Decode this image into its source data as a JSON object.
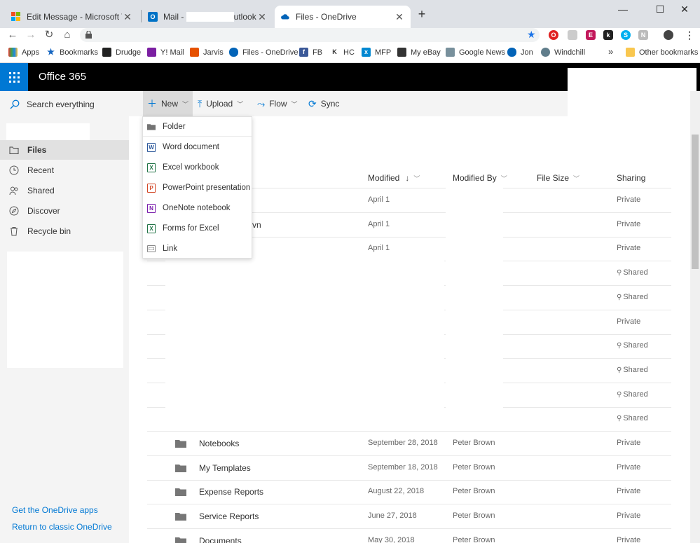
{
  "browser": {
    "tabs": [
      {
        "title": "Edit Message - Microsoft Tech Co",
        "favicon": "microsoft-icon"
      },
      {
        "title": "Mail - ",
        "title_suffix": "utlook",
        "favicon": "outlook-icon"
      },
      {
        "title": "Files - OneDrive",
        "favicon": "onedrive-icon",
        "active": true
      }
    ],
    "new_tab": "+",
    "window_controls": [
      "—",
      "☐",
      "✕"
    ],
    "nav": {
      "back": "←",
      "forward": "→",
      "reload": "↻",
      "home": "⌂"
    },
    "bookmarks": [
      {
        "label": "Apps",
        "icon": "apps-grid-icon"
      },
      {
        "label": "Bookmarks",
        "icon": "star-icon"
      },
      {
        "label": "Drudge",
        "icon": "drudge-icon"
      },
      {
        "label": "Y! Mail",
        "icon": "yahoo-mail-icon"
      },
      {
        "label": "Jarvis",
        "icon": "jarvis-icon"
      },
      {
        "label": "Files - OneDrive",
        "icon": "onedrive-icon"
      },
      {
        "label": "FB",
        "icon": "facebook-icon"
      },
      {
        "label": "HC",
        "icon": "hc-icon"
      },
      {
        "label": "MFP",
        "icon": "mfp-icon"
      },
      {
        "label": "My eBay",
        "icon": "ebay-icon"
      },
      {
        "label": "Google News",
        "icon": "google-news-icon"
      },
      {
        "label": "Jon",
        "icon": "onedrive-icon"
      },
      {
        "label": "Windchill",
        "icon": "windchill-icon"
      }
    ],
    "bookmarks_overflow": "»",
    "other_bookmarks": "Other bookmarks"
  },
  "suite": {
    "title": "Office 365"
  },
  "leftnav": {
    "search_placeholder": "Search everything",
    "items": [
      {
        "label": "Files",
        "icon": "files-icon",
        "selected": true
      },
      {
        "label": "Recent",
        "icon": "clock-icon"
      },
      {
        "label": "Shared",
        "icon": "people-icon"
      },
      {
        "label": "Discover",
        "icon": "discover-icon"
      },
      {
        "label": "Recycle bin",
        "icon": "recycle-bin-icon"
      }
    ],
    "get_apps": "Get the OneDrive apps",
    "return_classic": "Return to classic OneDrive"
  },
  "commandbar": {
    "new": "New",
    "upload": "Upload",
    "flow": "Flow",
    "sync": "Sync"
  },
  "new_menu": [
    {
      "label": "Folder",
      "icon": "folder-icon",
      "color": "#737373"
    },
    {
      "label": "Word document",
      "icon": "word-icon",
      "color": "#2b579a"
    },
    {
      "label": "Excel workbook",
      "icon": "excel-icon",
      "color": "#217346"
    },
    {
      "label": "PowerPoint presentation",
      "icon": "powerpoint-icon",
      "color": "#d24726"
    },
    {
      "label": "OneNote notebook",
      "icon": "onenote-icon",
      "color": "#7719aa"
    },
    {
      "label": "Forms for Excel",
      "icon": "forms-icon",
      "color": "#217346"
    },
    {
      "label": "Link",
      "icon": "link-icon",
      "color": "#888888"
    }
  ],
  "columns": {
    "modified": "Modified",
    "modified_by": "Modified By",
    "file_size": "File Size",
    "sharing": "Sharing",
    "sort_indicator": "↓"
  },
  "rows": [
    {
      "name": "",
      "modified": "April 1",
      "modified_by": "",
      "sharing": "Private",
      "shared": false,
      "folder": false
    },
    {
      "name": "vn",
      "modified": "April 1",
      "modified_by": "",
      "sharing": "Private",
      "shared": false,
      "folder": false
    },
    {
      "name": "",
      "modified": "April 1",
      "modified_by": "",
      "sharing": "Private",
      "shared": false,
      "folder": false
    },
    {
      "name": "",
      "modified": "",
      "modified_by": "",
      "sharing": "Shared",
      "shared": true,
      "folder": false
    },
    {
      "name": "",
      "modified": "",
      "modified_by": "",
      "sharing": "Shared",
      "shared": true,
      "folder": false
    },
    {
      "name": "",
      "modified": "",
      "modified_by": "",
      "sharing": "Private",
      "shared": false,
      "folder": false
    },
    {
      "name": "",
      "modified": "",
      "modified_by": "",
      "sharing": "Shared",
      "shared": true,
      "folder": false
    },
    {
      "name": "",
      "modified": "",
      "modified_by": "",
      "sharing": "Shared",
      "shared": true,
      "folder": false
    },
    {
      "name": "",
      "modified": "",
      "modified_by": "",
      "sharing": "Shared",
      "shared": true,
      "folder": false
    },
    {
      "name": "",
      "modified": "",
      "modified_by": "",
      "sharing": "Shared",
      "shared": true,
      "folder": false
    },
    {
      "name": "Notebooks",
      "modified": "September 28, 2018",
      "modified_by": "Peter Brown",
      "sharing": "Private",
      "shared": false,
      "folder": true
    },
    {
      "name": "My Templates",
      "modified": "September 18, 2018",
      "modified_by": "Peter Brown",
      "sharing": "Private",
      "shared": false,
      "folder": true
    },
    {
      "name": "Expense Reports",
      "modified": "August 22, 2018",
      "modified_by": "Peter Brown",
      "sharing": "Private",
      "shared": false,
      "folder": true
    },
    {
      "name": "Service Reports",
      "modified": "June 27, 2018",
      "modified_by": "Peter Brown",
      "sharing": "Private",
      "shared": false,
      "folder": true
    },
    {
      "name": "Documents",
      "modified": "May 30, 2018",
      "modified_by": "Peter Brown",
      "sharing": "Private",
      "shared": false,
      "folder": true
    }
  ],
  "colors": {
    "accent": "#0078d4",
    "suitebar": "#000000",
    "nav_bg": "#f4f4f4"
  }
}
